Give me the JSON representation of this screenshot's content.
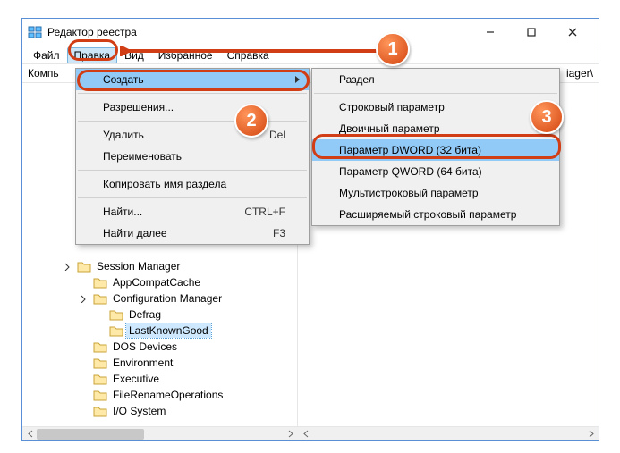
{
  "window": {
    "title": "Редактор реестра",
    "minimize": "—",
    "maximize": "□",
    "close": "✕"
  },
  "menubar": [
    "Файл",
    "Правка",
    "Вид",
    "Избранное",
    "Справка"
  ],
  "address": {
    "left": "Компь",
    "right": "iager\\"
  },
  "edit_menu": {
    "create": "Создать",
    "permissions": "Разрешения...",
    "delete": "Удалить",
    "delete_sc": "Del",
    "rename": "Переименовать",
    "copyname": "Копировать имя раздела",
    "find": "Найти...",
    "find_sc": "CTRL+F",
    "findnext": "Найти далее",
    "findnext_sc": "F3"
  },
  "create_menu": {
    "key": "Раздел",
    "string": "Строковый параметр",
    "binary": "Двоичный параметр",
    "dword": "Параметр DWORD (32 бита)",
    "qword": "Параметр QWORD (64 бита)",
    "multi": "Мультистроковый параметр",
    "expand": "Расширяемый строковый параметр"
  },
  "tree": {
    "n0": "Session Manager",
    "n1": "AppCompatCache",
    "n2": "Configuration Manager",
    "n3": "Defrag",
    "n4": "LastKnownGood",
    "n5": "DOS Devices",
    "n6": "Environment",
    "n7": "Executive",
    "n8": "FileRenameOperations",
    "n9": "I/O System"
  },
  "badges": {
    "b1": "1",
    "b2": "2",
    "b3": "3"
  }
}
